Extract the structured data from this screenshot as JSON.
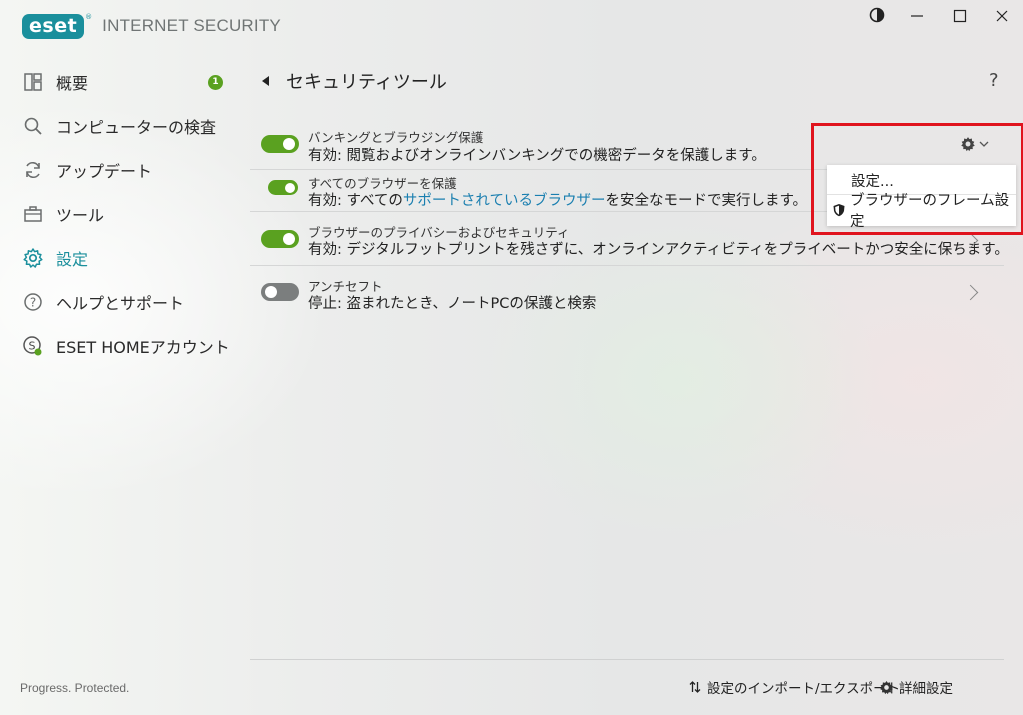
{
  "app": {
    "logo_text": "eset",
    "product_name": "INTERNET SECURITY"
  },
  "window_controls": {
    "theme_icon": "contrast-icon",
    "minimize_icon": "minimize-icon",
    "maximize_icon": "maximize-icon",
    "close_icon": "close-icon"
  },
  "sidebar": {
    "items": [
      {
        "label": "概要",
        "icon": "dashboard-icon",
        "badge": "1"
      },
      {
        "label": "コンピューターの検査",
        "icon": "search-icon"
      },
      {
        "label": "アップデート",
        "icon": "refresh-icon"
      },
      {
        "label": "ツール",
        "icon": "toolbox-icon"
      },
      {
        "label": "設定",
        "icon": "gear-icon",
        "active": true
      },
      {
        "label": "ヘルプとサポート",
        "icon": "help-icon"
      },
      {
        "label": "ESET HOMEアカウント",
        "icon": "account-icon"
      }
    ],
    "footer": "Progress. Protected."
  },
  "main": {
    "title": "セキュリティツール",
    "help_label": "?",
    "rows": [
      {
        "title": "バンキングとブラウジング保護",
        "status": "有効:",
        "desc": " 閲覧およびオンラインバンキングでの機密データを保護します。",
        "enabled": true
      },
      {
        "title": "すべてのブラウザーを保護",
        "status": "有効:",
        "desc_pre": " すべての",
        "link": "サポートされているブラウザー",
        "desc_post": "を安全なモードで実行します。",
        "enabled": true
      },
      {
        "title": "ブラウザーのプライバシーおよびセキュリティ",
        "status": "有効:",
        "desc": " デジタルフットプリントを残さずに、オンラインアクティビティをプライベートかつ安全に保ちます。",
        "enabled": true
      },
      {
        "title": "アンチセフト",
        "status": "停止:",
        "desc": " 盗まれたとき、ノートPCの保護と検索",
        "enabled": false
      }
    ],
    "gear_menu": {
      "items": [
        {
          "label": "設定..."
        },
        {
          "label": "ブラウザーのフレーム設定",
          "icon": "shield-icon"
        }
      ]
    }
  },
  "bottom_bar": {
    "import_export": "設定のインポート/エクスポート",
    "advanced": "詳細設定"
  },
  "colors": {
    "accent": "#1a8f9c",
    "toggle_on": "#5aa120",
    "toggle_off": "#7b7e7e",
    "highlight": "#e0141e",
    "link": "#1a7fb0"
  }
}
